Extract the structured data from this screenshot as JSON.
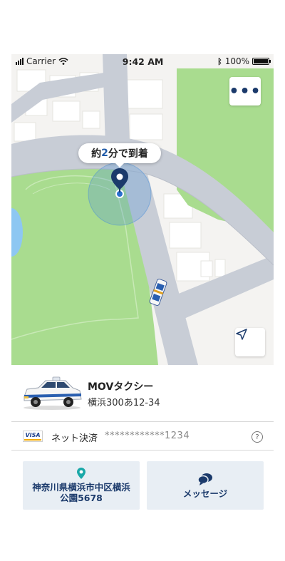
{
  "status_bar": {
    "carrier": "Carrier",
    "time": "9:42 AM",
    "battery": "100%",
    "battery_level": 1.0
  },
  "map": {
    "eta_prefix": "約",
    "eta_minutes": "2",
    "eta_suffix": "分で到着",
    "more_label": "•••",
    "colors": {
      "park": "#a9dc8f",
      "road": "#c8cdd6",
      "block": "#f4f3f1",
      "building": "#ffffff",
      "water": "#8dc7f2",
      "pin": "#1b3a6b",
      "accuracy": "#4a90d9"
    }
  },
  "vehicle": {
    "name": "MOVタクシー",
    "plate": "横浜300あ12-34"
  },
  "payment": {
    "card_brand": "VISA",
    "method": "ネット決済",
    "card_number": "************1234",
    "help": "?"
  },
  "actions": {
    "destination_line1": "神奈川県横浜市中区横浜",
    "destination_line2": "公園5678",
    "message": "メッセージ"
  }
}
